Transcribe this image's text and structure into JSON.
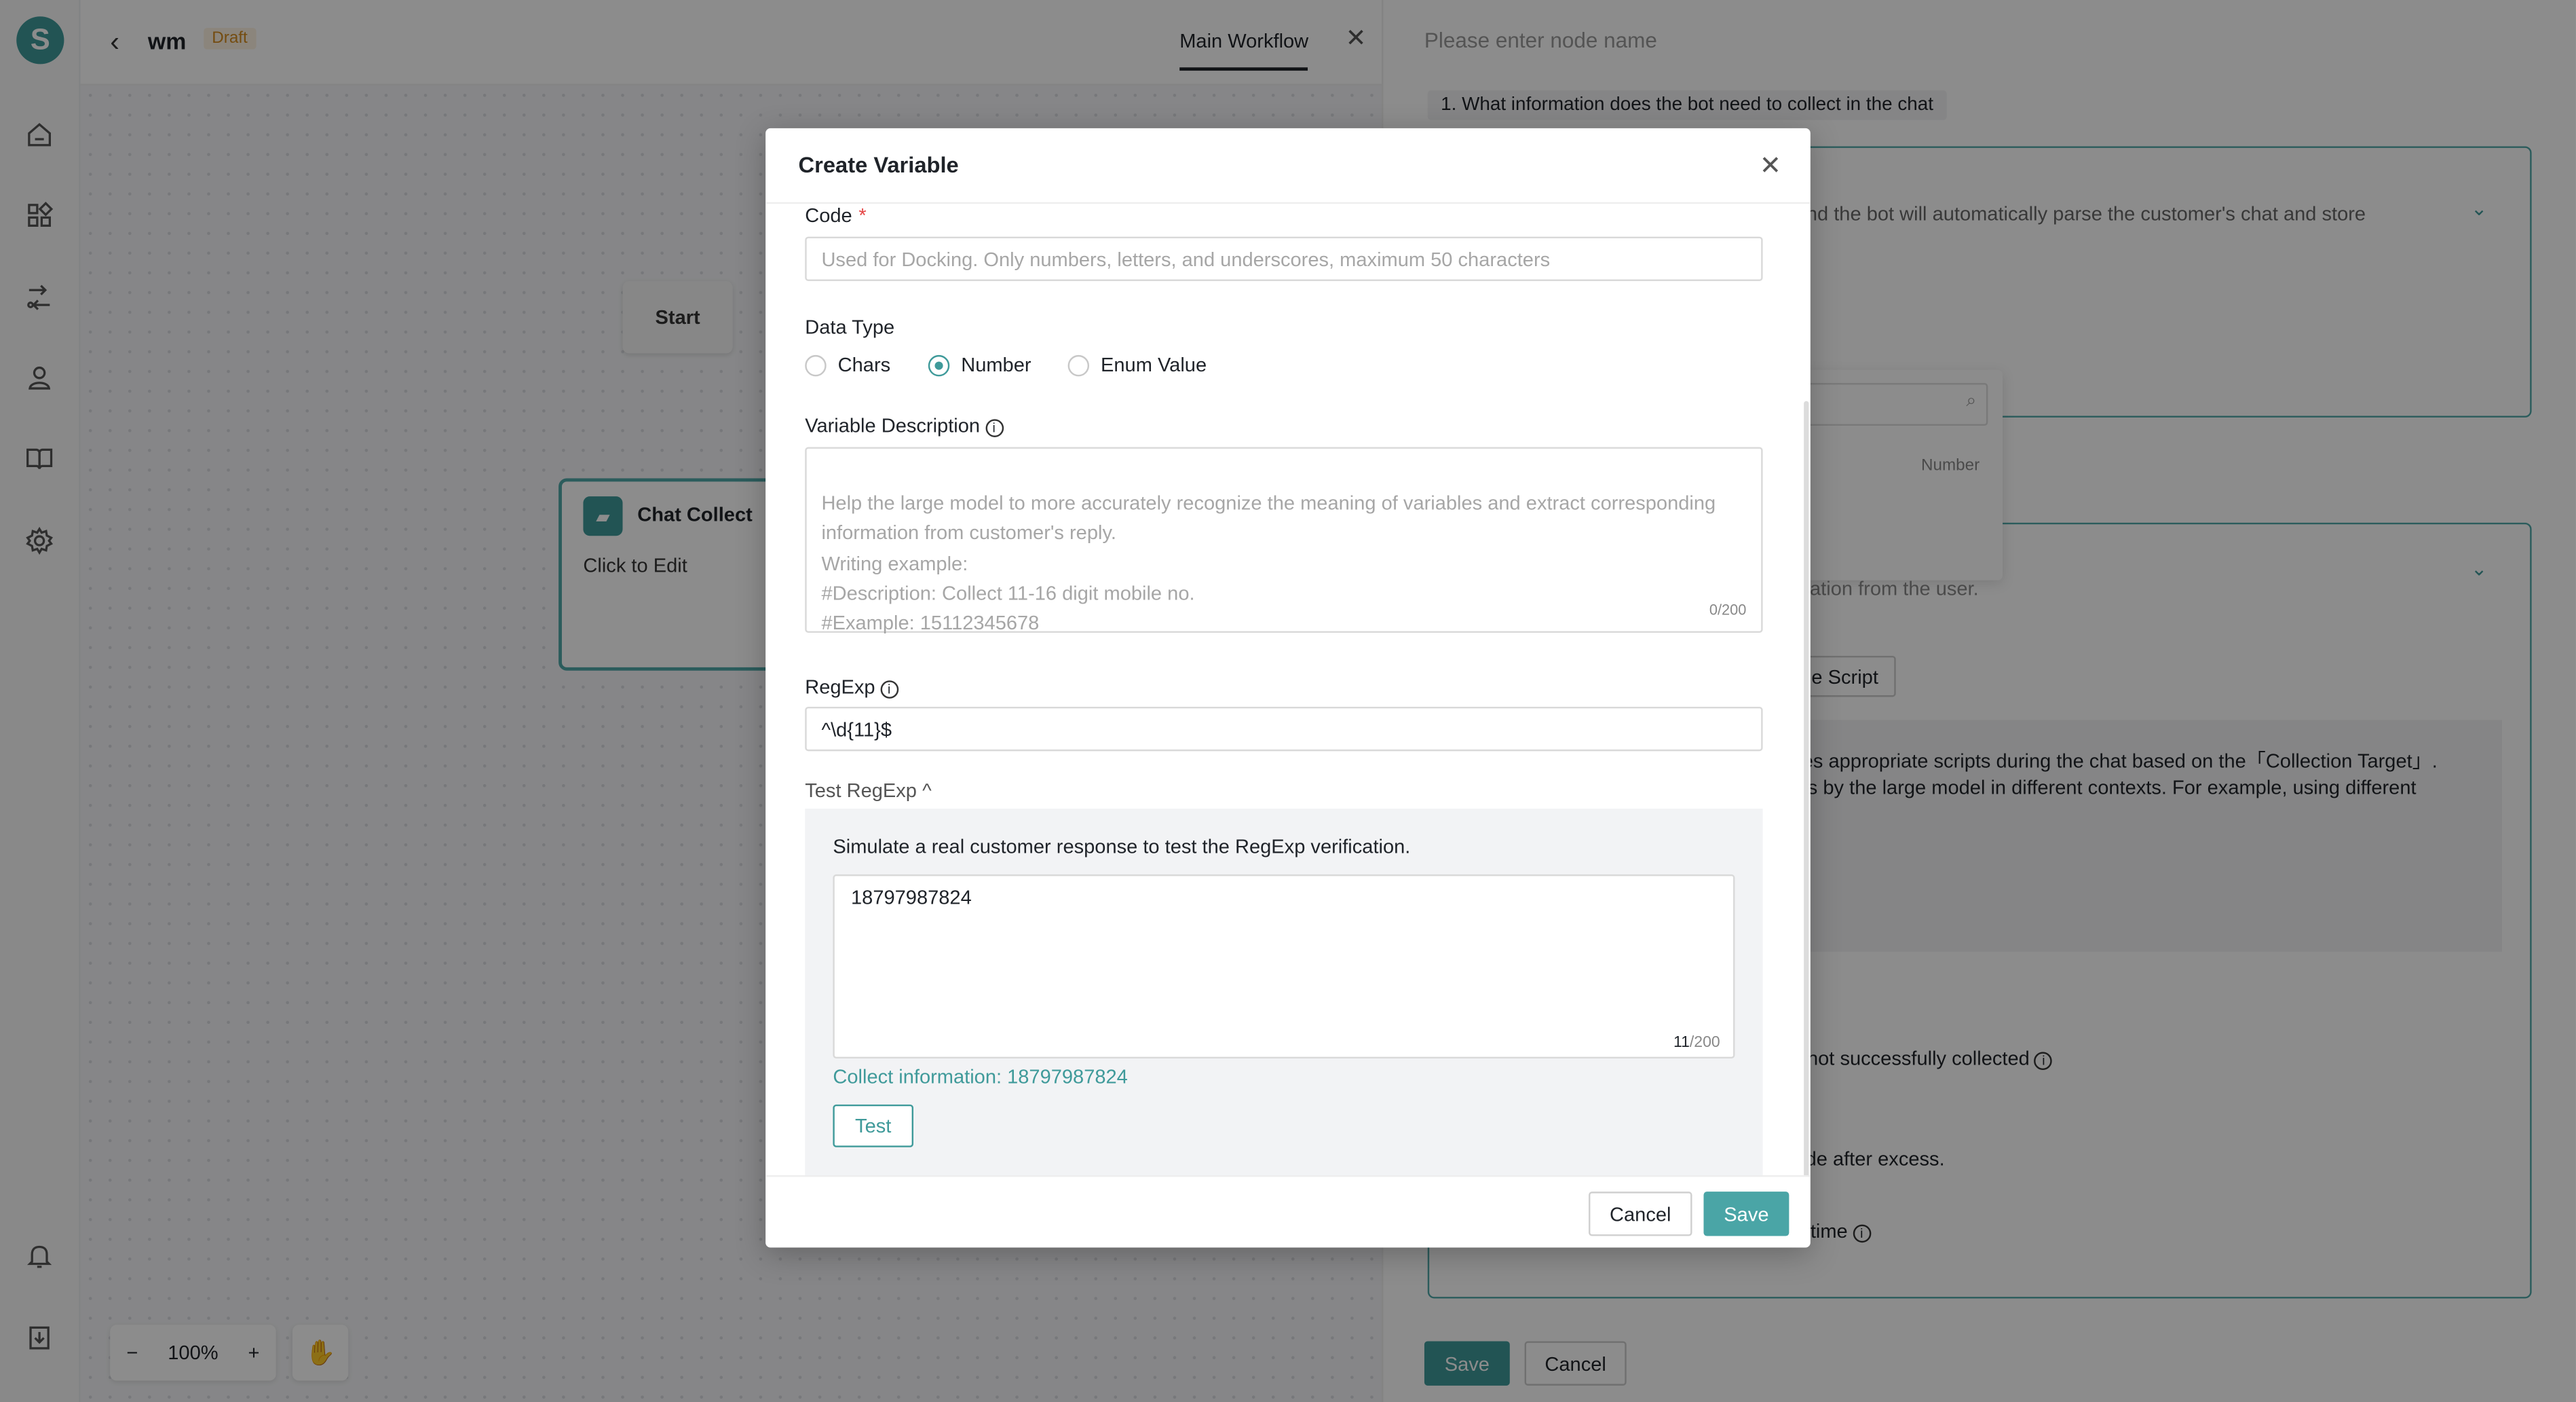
{
  "app": {
    "logo_letter": "S",
    "project_name": "wm",
    "status_badge": "Draft",
    "workflow_tab": "Main Workflow"
  },
  "rail": {
    "icons": [
      "home-icon",
      "apps-icon",
      "flow-icon",
      "user-icon",
      "book-icon",
      "gear-icon",
      "bell-icon",
      "download-icon"
    ]
  },
  "canvas": {
    "start_node": "Start",
    "chat_node": {
      "title": "Chat Collect",
      "subtitle": "Click to Edit"
    },
    "zoom": {
      "minus": "−",
      "level": "100%",
      "plus": "+"
    }
  },
  "panel": {
    "node_name_placeholder": "Please enter node name",
    "question1": "1. What information does the bot need to collect in the chat",
    "card1_fragment": "d, and the bot will automatically parse the customer's chat and store",
    "dropdown_number": "Number",
    "fragment_from_user": "iation from the user.",
    "script_button": "e Script",
    "script_desc_line1": "es appropriate scripts during the chat based on the「Collection Target」.",
    "script_desc_line2": "ts by the large model in different contexts. For example, using different",
    "not_collected": "not successfully collected",
    "after_excess": "de after excess.",
    "time_label": "time",
    "save": "Save",
    "cancel": "Cancel"
  },
  "modal": {
    "title": "Create Variable",
    "code": {
      "label": "Code",
      "required_mark": "*",
      "placeholder": "Used for Docking. Only numbers, letters, and underscores, maximum 50 characters"
    },
    "data_type": {
      "label": "Data Type",
      "options": [
        "Chars",
        "Number",
        "Enum Value"
      ],
      "selected": "Number"
    },
    "description": {
      "label": "Variable Description",
      "placeholder": "Help the large model to more accurately recognize the meaning of variables and extract corresponding information from customer's reply.\nWriting example:\n#Description: Collect 11-16 digit mobile no.\n#Example: 15112345678",
      "count": "0/200"
    },
    "regexp": {
      "label": "RegExp",
      "value": "^\\d{11}$"
    },
    "test": {
      "toggle_label": "Test RegExp",
      "hint": "Simulate a real customer response to test the RegExp verification.",
      "input_value": "18797987824",
      "count_current": "11",
      "count_max": "/200",
      "result": "Collect information: 18797987824",
      "button": "Test"
    },
    "footer": {
      "cancel": "Cancel",
      "save": "Save"
    }
  }
}
